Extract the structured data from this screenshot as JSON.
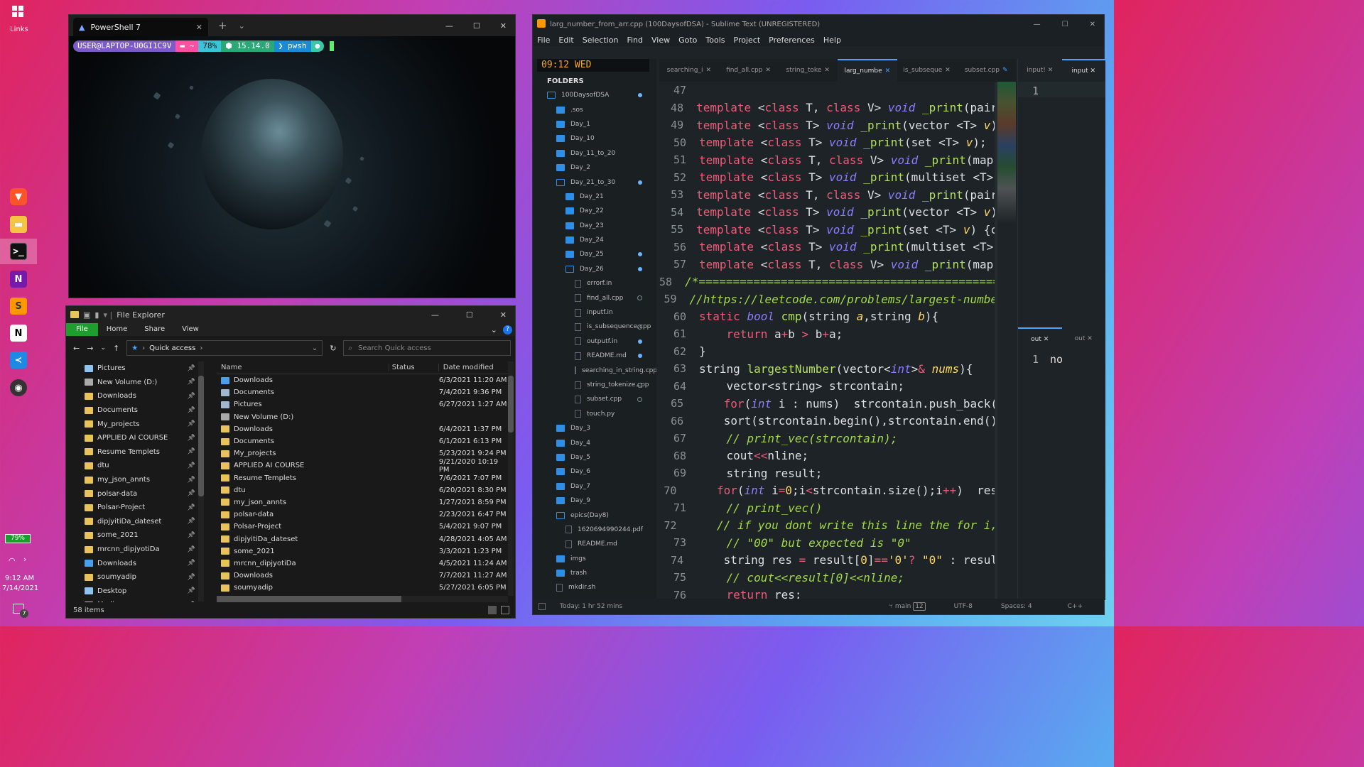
{
  "desktop": {
    "links_label": "Links",
    "battery": "79%",
    "time": "9:12 AM",
    "date": "7/14/2021",
    "notif_count": "7"
  },
  "terminal": {
    "tab_title": "PowerShell 7",
    "user": "USER@LAPTOP-U0GI1C9V",
    "dir": "~",
    "battery": "78%",
    "version": "15.14.0",
    "shell": "pwsh"
  },
  "explorer": {
    "title": "File Explorer",
    "ribbon": [
      "File",
      "Home",
      "Share",
      "View"
    ],
    "address": "Quick access",
    "search_placeholder": "Search Quick access",
    "nav": [
      {
        "label": "Pictures"
      },
      {
        "label": "New Volume (D:)"
      },
      {
        "label": "Downloads"
      },
      {
        "label": "Documents"
      },
      {
        "label": "My_projects"
      },
      {
        "label": "APPLIED AI COURSE"
      },
      {
        "label": "Resume Templets"
      },
      {
        "label": "dtu"
      },
      {
        "label": "my_json_annts"
      },
      {
        "label": "polsar-data"
      },
      {
        "label": "Polsar-Project"
      },
      {
        "label": "dipjyitiDa_dateset"
      },
      {
        "label": "some_2021"
      },
      {
        "label": "mrcnn_dipjyotiDa"
      },
      {
        "label": "Downloads"
      },
      {
        "label": "soumyadip"
      },
      {
        "label": "Desktop"
      },
      {
        "label": "Media"
      }
    ],
    "columns": {
      "name": "Name",
      "status": "Status",
      "date": "Date modified"
    },
    "files": [
      {
        "name": "Downloads",
        "date": "6/3/2021 11:20 AM"
      },
      {
        "name": "Documents",
        "date": "7/4/2021 9:36 PM"
      },
      {
        "name": "Pictures",
        "date": "6/27/2021 1:27 AM"
      },
      {
        "name": "New Volume (D:)",
        "date": ""
      },
      {
        "name": "Downloads",
        "date": "6/4/2021 1:37 PM"
      },
      {
        "name": "Documents",
        "date": "6/1/2021 6:13 PM"
      },
      {
        "name": "My_projects",
        "date": "5/23/2021 9:24 PM"
      },
      {
        "name": "APPLIED AI COURSE",
        "date": "9/21/2020 10:19 PM"
      },
      {
        "name": "Resume Templets",
        "date": "7/6/2021 7:07 PM"
      },
      {
        "name": "dtu",
        "date": "6/20/2021 8:30 PM"
      },
      {
        "name": "my_json_annts",
        "date": "1/27/2021 8:59 PM"
      },
      {
        "name": "polsar-data",
        "date": "2/23/2021 6:47 PM"
      },
      {
        "name": "Polsar-Project",
        "date": "5/4/2021 9:07 PM"
      },
      {
        "name": "dipjyitiDa_dateset",
        "date": "4/28/2021 4:05 AM"
      },
      {
        "name": "some_2021",
        "date": "3/3/2021 1:23 PM"
      },
      {
        "name": "mrcnn_dipjyotiDa",
        "date": "4/5/2021 11:24 AM"
      },
      {
        "name": "Downloads",
        "date": "7/7/2021 11:27 AM"
      },
      {
        "name": "soumyadip",
        "date": "5/27/2021 6:05 PM"
      }
    ],
    "status": "58 items"
  },
  "sublime": {
    "title": "larg_number_from_arr.cpp (100DaysofDSA) - Sublime Text (UNREGISTERED)",
    "menu": [
      "File",
      "Edit",
      "Selection",
      "Find",
      "View",
      "Goto",
      "Tools",
      "Project",
      "Preferences",
      "Help"
    ],
    "clock": "09:12 WED",
    "folders_label": "FOLDERS",
    "tabs": [
      "searching_i",
      "find_all.cpp",
      "string_toke",
      "larg_numbe",
      "is_subseque",
      "subset.cpp"
    ],
    "right_tabs": [
      "input!",
      "input"
    ],
    "out_tabs": [
      "out",
      "out"
    ],
    "input_line": "1",
    "out_line": "1",
    "out_text": "no",
    "status": {
      "time": "Today: 1 hr 52 mins",
      "branch": "main",
      "branch_count": "12",
      "encoding": "UTF-8",
      "spaces": "Spaces: 4",
      "lang": "C++"
    },
    "tree": [
      {
        "label": "100DaysofDSA",
        "lvl": 1,
        "kind": "open",
        "dot": "blue"
      },
      {
        "label": ".sos",
        "lvl": 2,
        "kind": "dir"
      },
      {
        "label": "Day_1",
        "lvl": 2,
        "kind": "dir"
      },
      {
        "label": "Day_10",
        "lvl": 2,
        "kind": "dir"
      },
      {
        "label": "Day_11_to_20",
        "lvl": 2,
        "kind": "dir"
      },
      {
        "label": "Day_2",
        "lvl": 2,
        "kind": "dir"
      },
      {
        "label": "Day_21_to_30",
        "lvl": 2,
        "kind": "open",
        "dot": "blue"
      },
      {
        "label": "Day_21",
        "lvl": 3,
        "kind": "dir"
      },
      {
        "label": "Day_22",
        "lvl": 3,
        "kind": "dir"
      },
      {
        "label": "Day_23",
        "lvl": 3,
        "kind": "dir"
      },
      {
        "label": "Day_24",
        "lvl": 3,
        "kind": "dir"
      },
      {
        "label": "Day_25",
        "lvl": 3,
        "kind": "dir",
        "dot": "blue"
      },
      {
        "label": "Day_26",
        "lvl": 3,
        "kind": "open",
        "dot": "blue"
      },
      {
        "label": "errorf.in",
        "lvl": 4,
        "kind": "file"
      },
      {
        "label": "find_all.cpp",
        "lvl": 4,
        "kind": "file",
        "dot": "hollow"
      },
      {
        "label": "inputf.in",
        "lvl": 4,
        "kind": "file"
      },
      {
        "label": "is_subsequence.cpp",
        "lvl": 4,
        "kind": "file",
        "dot": "hollow"
      },
      {
        "label": "outputf.in",
        "lvl": 4,
        "kind": "file",
        "dot": "blue"
      },
      {
        "label": "README.md",
        "lvl": 4,
        "kind": "file",
        "dot": "blue"
      },
      {
        "label": "searching_in_string.cpp",
        "lvl": 4,
        "kind": "file"
      },
      {
        "label": "string_tokenize.cpp",
        "lvl": 4,
        "kind": "file",
        "dot": "hollow"
      },
      {
        "label": "subset.cpp",
        "lvl": 4,
        "kind": "file",
        "dot": "hollow"
      },
      {
        "label": "touch.py",
        "lvl": 4,
        "kind": "file"
      },
      {
        "label": "Day_3",
        "lvl": 2,
        "kind": "dir"
      },
      {
        "label": "Day_4",
        "lvl": 2,
        "kind": "dir"
      },
      {
        "label": "Day_5",
        "lvl": 2,
        "kind": "dir"
      },
      {
        "label": "Day_6",
        "lvl": 2,
        "kind": "dir"
      },
      {
        "label": "Day_7",
        "lvl": 2,
        "kind": "dir"
      },
      {
        "label": "Day_9",
        "lvl": 2,
        "kind": "dir"
      },
      {
        "label": "epics(Day8)",
        "lvl": 2,
        "kind": "open"
      },
      {
        "label": "1620694990244.pdf",
        "lvl": 3,
        "kind": "file"
      },
      {
        "label": "README.md",
        "lvl": 3,
        "kind": "file"
      },
      {
        "label": "imgs",
        "lvl": 2,
        "kind": "dir"
      },
      {
        "label": "trash",
        "lvl": 2,
        "kind": "dir"
      },
      {
        "label": "mkdir.sh",
        "lvl": 2,
        "kind": "file"
      }
    ],
    "code": [
      {
        "n": "47",
        "html": ""
      },
      {
        "n": "48",
        "html": "<span class='k'>template</span> <span class='p'>&lt;</span><span class='k'>class</span> T, <span class='k'>class</span> V&gt; <span class='ty'>void</span> <span class='f'>_print</span>(pair"
      },
      {
        "n": "49",
        "html": "<span class='k'>template</span> &lt;<span class='k'>class</span> T&gt; <span class='ty'>void</span> <span class='f'>_print</span>(vector &lt;T&gt; <span class='a'>v</span>)"
      },
      {
        "n": "50",
        "html": "<span class='k'>template</span> &lt;<span class='k'>class</span> T&gt; <span class='ty'>void</span> <span class='f'>_print</span>(set &lt;T&gt; <span class='a'>v</span>);"
      },
      {
        "n": "51",
        "html": "<span class='k'>template</span> &lt;<span class='k'>class</span> T, <span class='k'>class</span> V&gt; <span class='ty'>void</span> <span class='f'>_print</span>(map"
      },
      {
        "n": "52",
        "html": "<span class='k'>template</span> &lt;<span class='k'>class</span> T&gt; <span class='ty'>void</span> <span class='f'>_print</span>(multiset &lt;T&gt;"
      },
      {
        "n": "53",
        "html": "<span class='k'>template</span> &lt;<span class='k'>class</span> T, <span class='k'>class</span> V&gt; <span class='ty'>void</span> <span class='f'>_print</span>(pair"
      },
      {
        "n": "54",
        "html": "<span class='k'>template</span> &lt;<span class='k'>class</span> T&gt; <span class='ty'>void</span> <span class='f'>_print</span>(vector &lt;T&gt; <span class='a'>v</span>)"
      },
      {
        "n": "55",
        "html": "<span class='k'>template</span> &lt;<span class='k'>class</span> T&gt; <span class='ty'>void</span> <span class='f'>_print</span>(set &lt;T&gt; <span class='a'>v</span>) {c"
      },
      {
        "n": "56",
        "html": "<span class='k'>template</span> &lt;<span class='k'>class</span> T&gt; <span class='ty'>void</span> <span class='f'>_print</span>(multiset &lt;T&gt;"
      },
      {
        "n": "57",
        "html": "<span class='k'>template</span> &lt;<span class='k'>class</span> T, <span class='k'>class</span> V&gt; <span class='ty'>void</span> <span class='f'>_print</span>(map"
      },
      {
        "n": "58",
        "html": "<span class='c'>/*=================================================</span>"
      },
      {
        "n": "59",
        "html": "<span class='c'>//https://leetcode.com/problems/largest-numbe</span>"
      },
      {
        "n": "60",
        "html": "<span class='k'>static</span> <span class='ty'>bool</span> <span class='f'>cmp</span>(string <span class='a'>a</span>,string <span class='a'>b</span>){"
      },
      {
        "n": "61",
        "html": "    <span class='k'>return</span> a<span class='k'>+</span>b <span class='k'>&gt;</span> b<span class='k'>+</span>a;"
      },
      {
        "n": "62",
        "html": "}"
      },
      {
        "n": "63",
        "html": "string <span class='f'>largestNumber</span>(vector&lt;<span class='ty'>int</span>&gt;<span class='k'>&amp;</span> <span class='a'>nums</span>){"
      },
      {
        "n": "64",
        "html": "    vector&lt;string&gt; strcontain;"
      },
      {
        "n": "65",
        "html": "    <span class='k'>for</span>(<span class='ty'>int</span> i : nums)  strcontain.push_back("
      },
      {
        "n": "66",
        "html": "    sort(strcontain.begin(),strcontain.end()"
      },
      {
        "n": "67",
        "html": "    <span class='c'>// print_vec(strcontain);</span>"
      },
      {
        "n": "68",
        "html": "    cout<span class='k'>&lt;&lt;</span>nline;"
      },
      {
        "n": "69",
        "html": "    string result;"
      },
      {
        "n": "70",
        "html": "    <span class='k'>for</span>(<span class='ty'>int</span> i<span class='k'>=</span><span class='s'>0</span>;i<span class='k'>&lt;</span>strcontain.size();i<span class='k'>++</span>)  res"
      },
      {
        "n": "71",
        "html": "    <span class='c'>// print_vec()</span>"
      },
      {
        "n": "72",
        "html": "    <span class='c'>// if you dont write this line the for i,</span>"
      },
      {
        "n": "73",
        "html": "    <span class='c'>// \"00\" but expected is \"0\"</span>"
      },
      {
        "n": "74",
        "html": "    string res <span class='k'>=</span> result[<span class='s'>0</span>]<span class='k'>==</span><span class='s'>'0'</span><span class='k'>?</span> <span class='s'>\"0\"</span> : resul"
      },
      {
        "n": "75",
        "html": "    <span class='c'>// cout&lt;&lt;result[0]&lt;&lt;nline;</span>"
      },
      {
        "n": "76",
        "html": "    <span class='k'>return</span> res;"
      }
    ]
  }
}
